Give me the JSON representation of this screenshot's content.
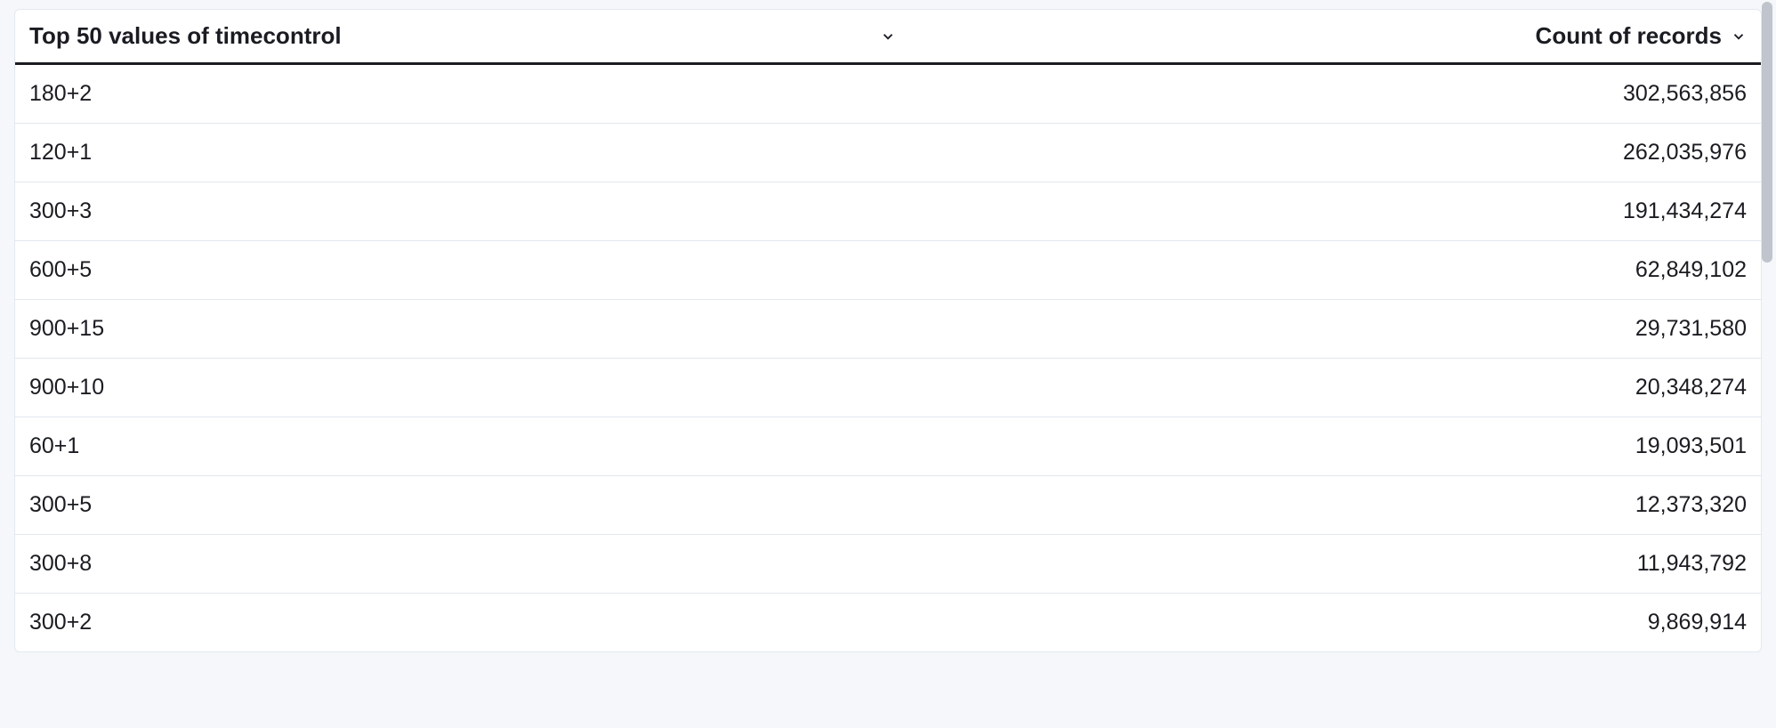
{
  "table": {
    "header": {
      "left_label": "Top 50 values of timecontrol",
      "right_label": "Count of records"
    },
    "rows": [
      {
        "value": "180+2",
        "count": "302,563,856"
      },
      {
        "value": "120+1",
        "count": "262,035,976"
      },
      {
        "value": "300+3",
        "count": "191,434,274"
      },
      {
        "value": "600+5",
        "count": "62,849,102"
      },
      {
        "value": "900+15",
        "count": "29,731,580"
      },
      {
        "value": "900+10",
        "count": "20,348,274"
      },
      {
        "value": "60+1",
        "count": "19,093,501"
      },
      {
        "value": "300+5",
        "count": "12,373,320"
      },
      {
        "value": "300+8",
        "count": "11,943,792"
      },
      {
        "value": "300+2",
        "count": "9,869,914"
      }
    ]
  }
}
